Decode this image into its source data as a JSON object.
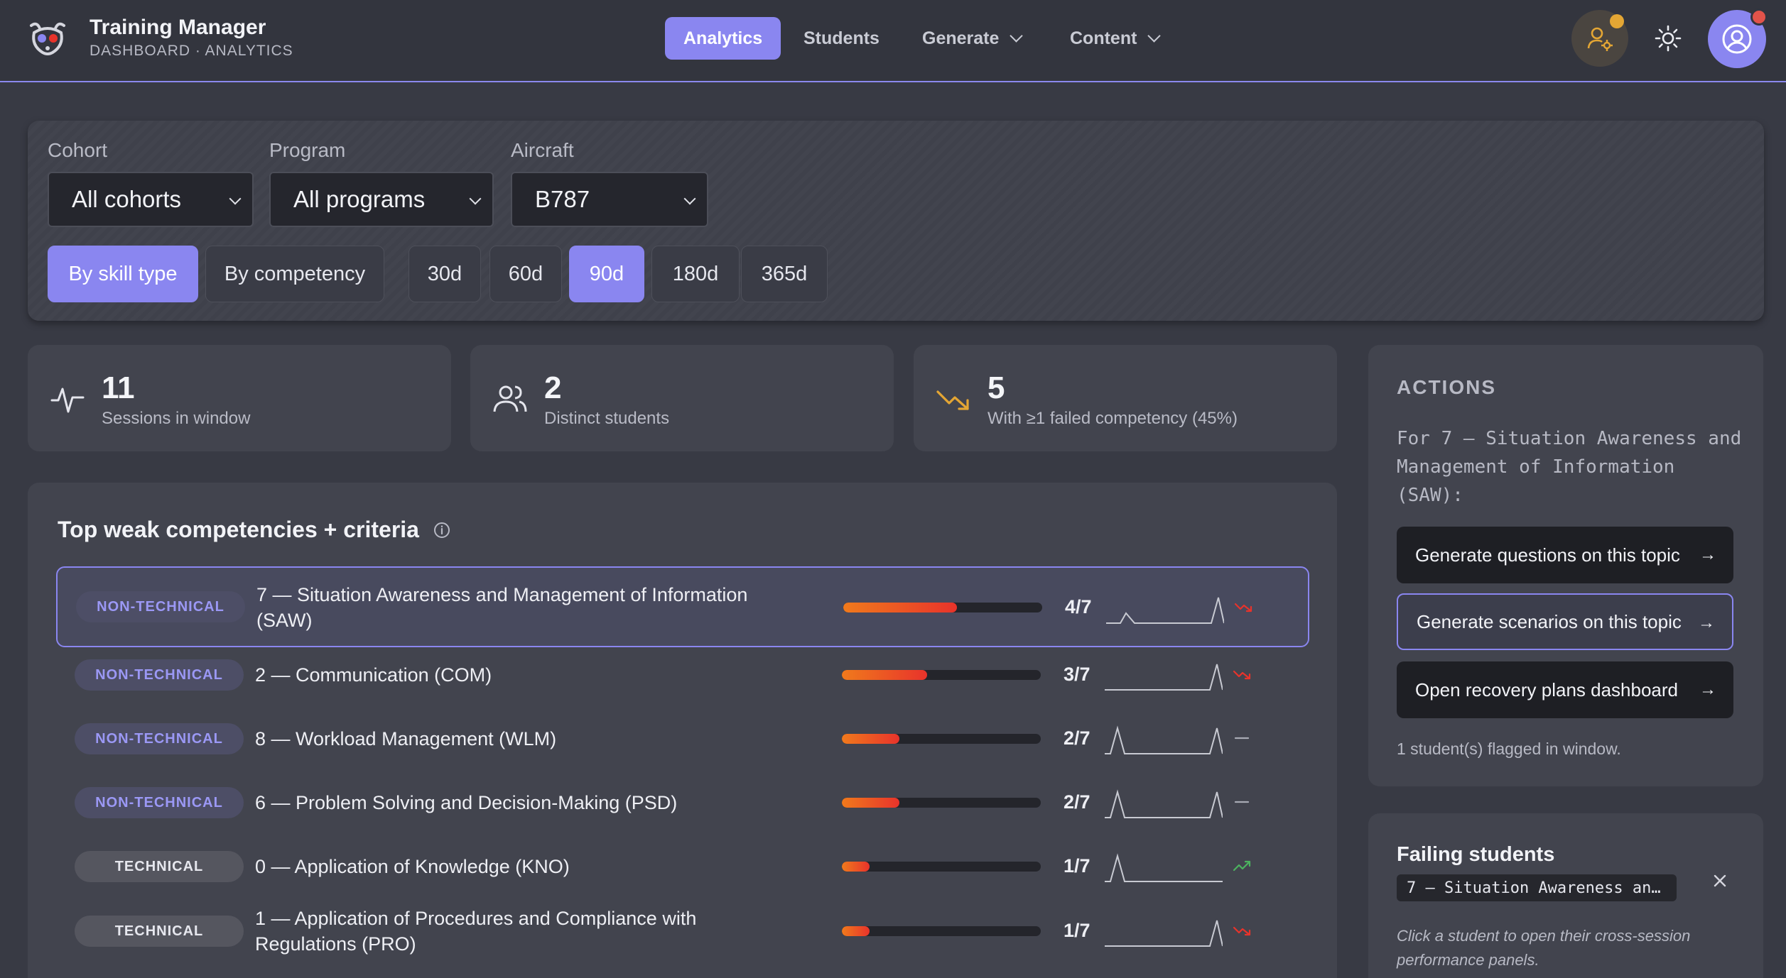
{
  "header": {
    "app_title": "Training Manager",
    "app_subtitle": "DASHBOARD · ANALYTICS",
    "nav": [
      {
        "label": "Analytics",
        "active": true
      },
      {
        "label": "Students",
        "active": false
      },
      {
        "label": "Generate",
        "dropdown": true
      },
      {
        "label": "Content",
        "dropdown": true
      }
    ],
    "icons": [
      "instructor-settings-icon",
      "sun-icon",
      "user-account-icon"
    ],
    "colors": {
      "accent": "#8a86f0",
      "notification": "#e2534a",
      "warning_badge": "#e4a634"
    }
  },
  "filters": {
    "cohort": {
      "label": "Cohort",
      "value": "All cohorts"
    },
    "program": {
      "label": "Program",
      "value": "All programs"
    },
    "aircraft": {
      "label": "Aircraft",
      "value": "B787"
    },
    "group_by": [
      {
        "label": "By skill type",
        "active": true
      },
      {
        "label": "By competency",
        "active": false
      }
    ],
    "windows": [
      {
        "label": "30d",
        "active": false
      },
      {
        "label": "60d",
        "active": false
      },
      {
        "label": "90d",
        "active": true
      },
      {
        "label": "180d",
        "active": false
      },
      {
        "label": "365d",
        "active": false
      }
    ]
  },
  "stats": [
    {
      "value": "11",
      "label": "Sessions in window",
      "icon": "activity-icon"
    },
    {
      "value": "2",
      "label": "Distinct students",
      "icon": "users-icon"
    },
    {
      "value": "5",
      "label": "With ≥1 failed competency (45%)",
      "icon": "trending-down-icon"
    }
  ],
  "weak": {
    "title": "Top weak competencies + criteria",
    "rows": [
      {
        "type": "NON-TECHNICAL",
        "name": "7 — Situation Awareness and Management of Information (SAW)",
        "score": "4/7",
        "fraction": 0.57,
        "trend": "down",
        "selected": true
      },
      {
        "type": "NON-TECHNICAL",
        "name": "2 — Communication (COM)",
        "score": "3/7",
        "fraction": 0.43,
        "trend": "down"
      },
      {
        "type": "NON-TECHNICAL",
        "name": "8 — Workload Management (WLM)",
        "score": "2/7",
        "fraction": 0.29,
        "trend": "flat"
      },
      {
        "type": "NON-TECHNICAL",
        "name": "6 — Problem Solving and Decision-Making (PSD)",
        "score": "2/7",
        "fraction": 0.29,
        "trend": "flat"
      },
      {
        "type": "TECHNICAL",
        "name": "0 — Application of Knowledge (KNO)",
        "score": "1/7",
        "fraction": 0.14,
        "trend": "up"
      },
      {
        "type": "TECHNICAL",
        "name": "1 — Application of Procedures and Compliance with Regulations (PRO)",
        "score": "1/7",
        "fraction": 0.14,
        "trend": "down"
      }
    ]
  },
  "actions": {
    "title": "ACTIONS",
    "for_text": "For 7 — Situation Awareness and Management of Information (SAW):",
    "buttons": [
      {
        "label": "Generate questions on this topic"
      },
      {
        "label": "Generate scenarios on this topic"
      },
      {
        "label": "Open recovery plans dashboard"
      }
    ],
    "note": "1 student(s) flagged in window."
  },
  "failing": {
    "title": "Failing students",
    "tag": "7 — Situation Awareness an…",
    "hint": "Click a student to open their cross-session performance panels."
  }
}
